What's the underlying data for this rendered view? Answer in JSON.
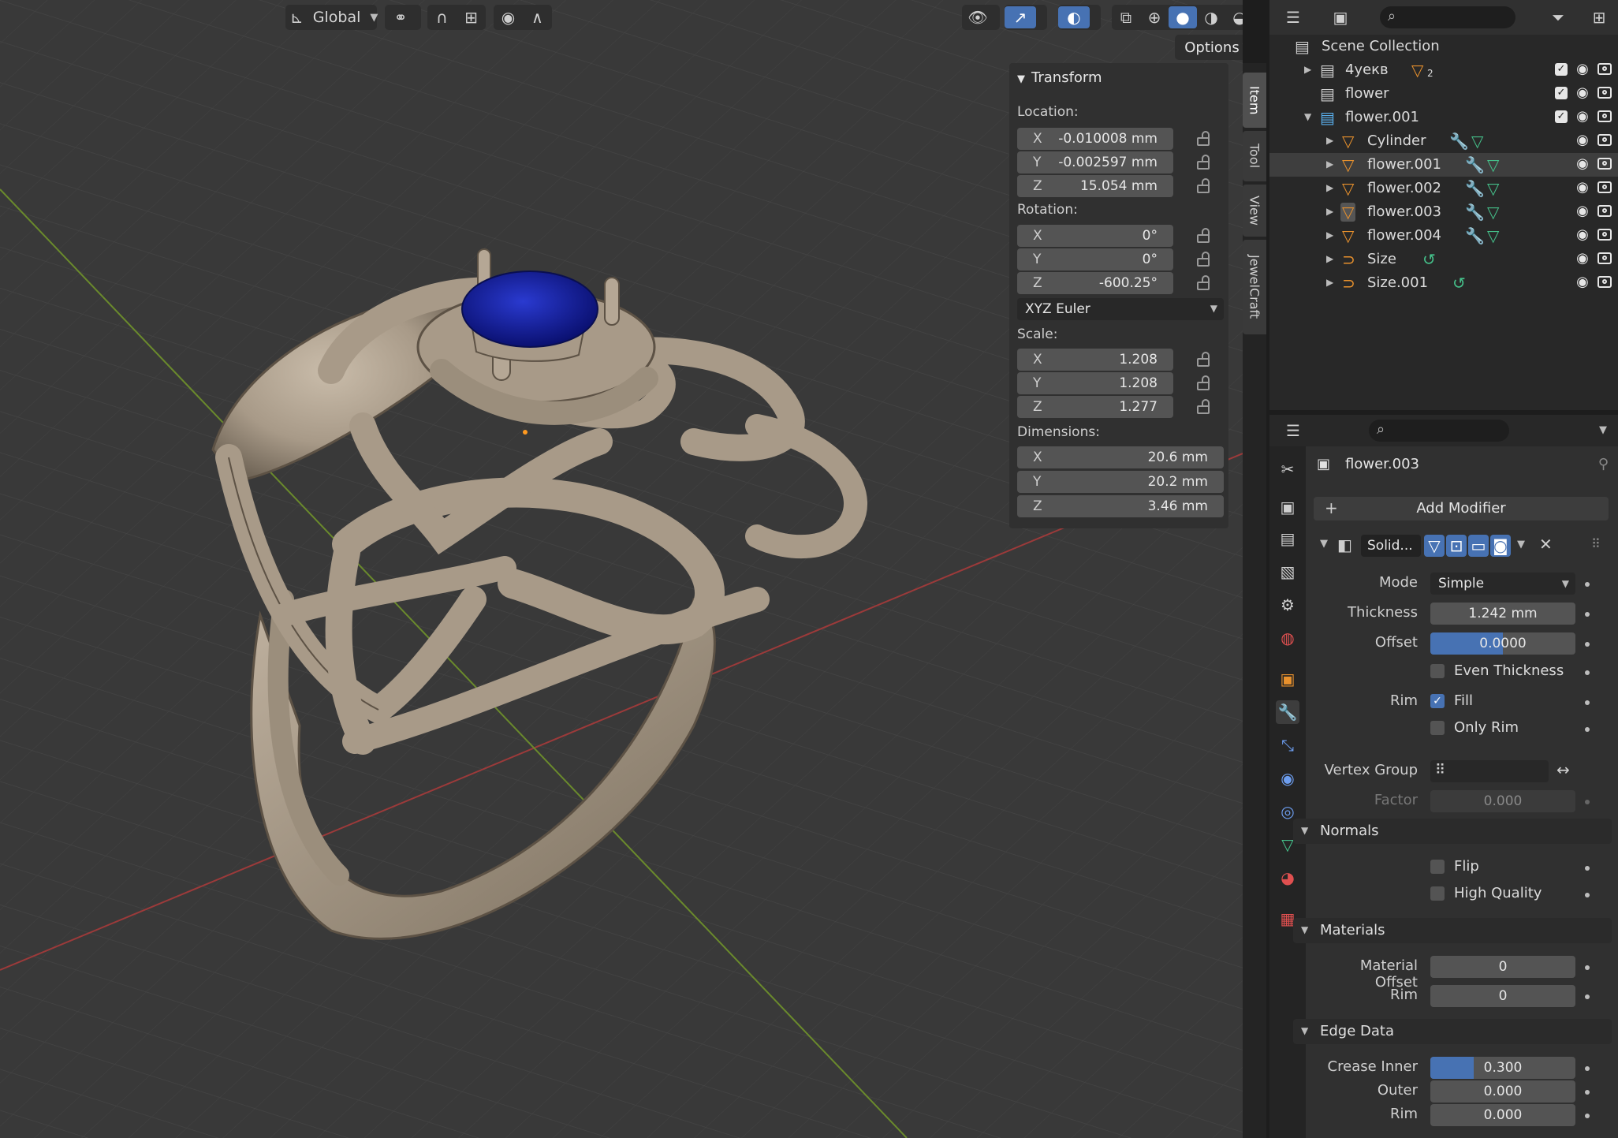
{
  "header": {
    "transform_orientation": "Global",
    "options_label": "Options"
  },
  "npanel": {
    "section_title": "Transform",
    "location_label": "Location:",
    "location": [
      {
        "axis": "X",
        "value": "-0.010008 mm"
      },
      {
        "axis": "Y",
        "value": "-0.002597 mm"
      },
      {
        "axis": "Z",
        "value": "15.054 mm"
      }
    ],
    "rotation_label": "Rotation:",
    "rotation": [
      {
        "axis": "X",
        "value": "0°"
      },
      {
        "axis": "Y",
        "value": "0°"
      },
      {
        "axis": "Z",
        "value": "-600.25°"
      }
    ],
    "rotation_mode": "XYZ Euler",
    "scale_label": "Scale:",
    "scale": [
      {
        "axis": "X",
        "value": "1.208"
      },
      {
        "axis": "Y",
        "value": "1.208"
      },
      {
        "axis": "Z",
        "value": "1.277"
      }
    ],
    "dimensions_label": "Dimensions:",
    "dimensions": [
      {
        "axis": "X",
        "value": "20.6 mm"
      },
      {
        "axis": "Y",
        "value": "20.2 mm"
      },
      {
        "axis": "Z",
        "value": "3.46 mm"
      }
    ],
    "tabs": [
      "Item",
      "Tool",
      "View",
      "JewelCraft"
    ]
  },
  "outliner": {
    "root": "Scene Collection",
    "rows": [
      {
        "label": "4уекв",
        "badge": "2",
        "kind": "collection"
      },
      {
        "label": "flower",
        "kind": "collection"
      },
      {
        "label": "flower.001",
        "kind": "collection-open"
      },
      {
        "label": "Cylinder",
        "kind": "mesh"
      },
      {
        "label": "flower.001",
        "kind": "mesh",
        "selected": true
      },
      {
        "label": "flower.002",
        "kind": "mesh"
      },
      {
        "label": "flower.003",
        "kind": "mesh-active"
      },
      {
        "label": "flower.004",
        "kind": "mesh"
      },
      {
        "label": "Size",
        "kind": "curve"
      },
      {
        "label": "Size.001",
        "kind": "curve"
      }
    ]
  },
  "properties": {
    "object_name": "flower.003",
    "add_modifier": "Add Modifier",
    "modifier_name": "Solid...",
    "mode_label": "Mode",
    "mode_value": "Simple",
    "thickness_label": "Thickness",
    "thickness_value": "1.242 mm",
    "offset_label": "Offset",
    "offset_value": "0.0000",
    "offset_fraction": 0.5,
    "even_thickness": "Even Thickness",
    "rim_label": "Rim",
    "fill_label": "Fill",
    "only_rim": "Only Rim",
    "vertex_group_label": "Vertex Group",
    "factor_label": "Factor",
    "factor_value": "0.000",
    "normals_title": "Normals",
    "flip_label": "Flip",
    "high_quality_label": "High Quality",
    "materials_title": "Materials",
    "material_offset_label": "Material Offset",
    "material_offset_value": "0",
    "material_rim_label": "Rim",
    "material_rim_value": "0",
    "edge_data_title": "Edge Data",
    "crease_inner_label": "Crease Inner",
    "crease_inner_value": "0.300",
    "crease_inner_fraction": 0.3,
    "outer_label": "Outer",
    "outer_value": "0.000",
    "edge_rim_label": "Rim",
    "edge_rim_value": "0.000"
  },
  "colors": {
    "accent": "#4772b3",
    "ring_metal": "#a89a88",
    "gem": "#0f1a9a",
    "x_axis": "#9c3a3a",
    "y_axis": "#6a8a2c"
  }
}
